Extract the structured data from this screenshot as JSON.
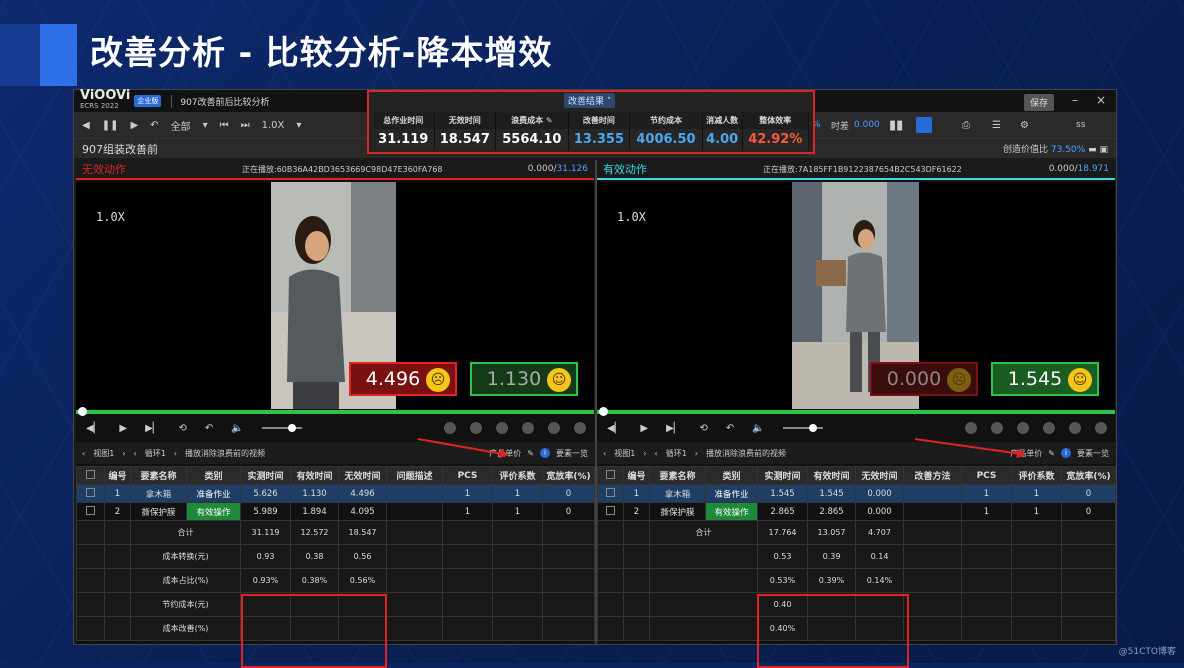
{
  "slide": {
    "title": "改善分析 - 比较分析-降本增效",
    "watermark": "@51CTO博客"
  },
  "app": {
    "logo": "ViOOVi",
    "edition": "ECRS 2022",
    "badge": "企业版",
    "project": "907改善前后比较分析",
    "save_label": "保存",
    "minimize": "–",
    "close": "×",
    "toolbar": {
      "scope": "全部",
      "rate": "1.0X",
      "diff_label": "时差",
      "diff_value": "0.000",
      "pct_value": "%",
      "user": "ss"
    },
    "info": {
      "title": "907组装改善前",
      "value_ratio_label": "创造价值比",
      "value_ratio": "73.50%"
    },
    "result": {
      "tag": "改善结果 ˄",
      "headers": [
        "总作业时间",
        "无效时间",
        "浪费成本 ✎",
        "改善时间",
        "节约成本",
        "消减人数",
        "整体效率"
      ],
      "values": [
        "31.119",
        "18.547",
        "5564.10",
        "13.355",
        "4006.50",
        "4.00",
        "42.92%"
      ]
    },
    "colors": {
      "red": "#e02424",
      "green": "#2ec44a",
      "blue": "#2a6ad8",
      "cyan": "#3fd6e6"
    },
    "left": {
      "label": "无效动作",
      "playing": "正在播放:60B36A42BD3653669C98D47E360FA768",
      "time_cur": "0.000/",
      "time_total": "31.126",
      "speed": "1.0X",
      "bad_score": "4.496",
      "good_score": "1.130",
      "view": "视图1",
      "loop": "循环1",
      "filter": "播放消除浪费前的视频",
      "unit_price": "产品单价",
      "elements": "要素一览",
      "columns": [
        "编号",
        "要素名称",
        "类别",
        "实测时间",
        "有效时间",
        "无效时间",
        "问题描述",
        "PCS",
        "评价系数",
        "宽放率(%)"
      ],
      "rows": [
        {
          "no": "1",
          "name": "拿木箱",
          "cat": "准备作业",
          "measured": "5.626",
          "valid": "1.130",
          "invalid": "4.496",
          "desc": "",
          "pcs": "1",
          "eval": "1",
          "rate": "0"
        },
        {
          "no": "2",
          "name": "撕保护膜",
          "cat": "有效操作",
          "measured": "5.989",
          "valid": "1.894",
          "invalid": "4.095",
          "desc": "",
          "pcs": "1",
          "eval": "1",
          "rate": "0"
        }
      ],
      "summary": [
        {
          "label": "合计",
          "a": "31.119",
          "b": "12.572",
          "c": "18.547"
        },
        {
          "label": "成本转换(元)",
          "a": "0.93",
          "b": "0.38",
          "c": "0.56"
        },
        {
          "label": "成本占比(%)",
          "a": "0.93%",
          "b": "0.38%",
          "c": "0.56%"
        },
        {
          "label": "节约成本(元)",
          "a": "",
          "b": "",
          "c": ""
        },
        {
          "label": "成本改善(%)",
          "a": "",
          "b": "",
          "c": ""
        }
      ]
    },
    "right": {
      "label": "有效动作",
      "playing": "正在播放:7A185FF1B9122387654B2C543DF61622",
      "time_cur": "0.000/",
      "time_total": "18.971",
      "speed": "1.0X",
      "bad_score": "0.000",
      "good_score": "1.545",
      "view": "视图1",
      "loop": "循环1",
      "filter": "播放消除浪费前的视频",
      "unit_price": "产品单价",
      "elements": "要素一览",
      "columns": [
        "编号",
        "要素名称",
        "类别",
        "实测时间",
        "有效时间",
        "无效时间",
        "改善方法",
        "PCS",
        "评价系数",
        "宽放率(%)"
      ],
      "rows": [
        {
          "no": "1",
          "name": "拿木箱",
          "cat": "准备作业",
          "measured": "1.545",
          "valid": "1.545",
          "invalid": "0.000",
          "desc": "",
          "pcs": "1",
          "eval": "1",
          "rate": "0"
        },
        {
          "no": "2",
          "name": "撕保护膜",
          "cat": "有效操作",
          "measured": "2.865",
          "valid": "2.865",
          "invalid": "0.000",
          "desc": "",
          "pcs": "1",
          "eval": "1",
          "rate": "0"
        }
      ],
      "summary": [
        {
          "label": "合计",
          "a": "17.764",
          "b": "13.057",
          "c": "4.707"
        },
        {
          "label": "",
          "a": "0.53",
          "b": "0.39",
          "c": "0.14"
        },
        {
          "label": "",
          "a": "0.53%",
          "b": "0.39%",
          "c": "0.14%"
        },
        {
          "label": "",
          "a": "0.40",
          "b": "",
          "c": ""
        },
        {
          "label": "",
          "a": "0.40%",
          "b": "",
          "c": ""
        }
      ]
    }
  }
}
